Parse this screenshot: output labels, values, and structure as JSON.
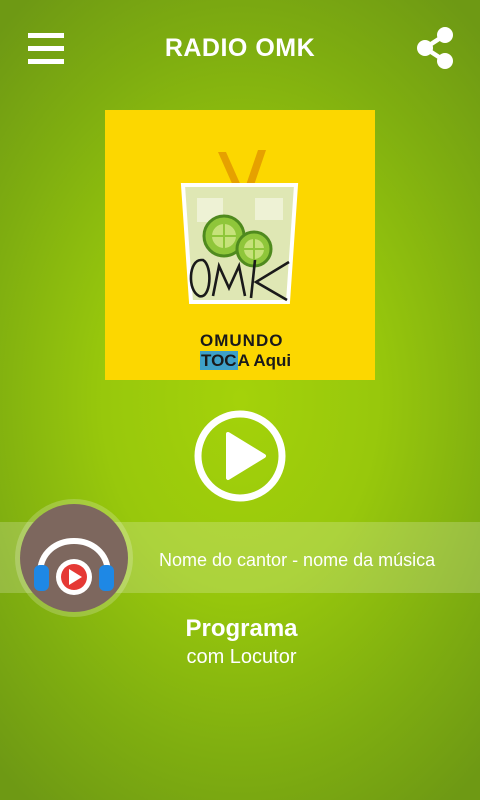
{
  "header": {
    "title": "RADIO OMK",
    "menu_icon": "hamburger-menu-icon",
    "share_icon": "share-icon"
  },
  "logo": {
    "signature": "OMK",
    "line1": "OMUNDO",
    "line2_highlight": "TOC",
    "line2_rest": "A Aqui"
  },
  "player": {
    "play_icon": "play-icon",
    "track": "Nome do cantor - nome da música"
  },
  "program": {
    "avatar_icon": "headphones-icon",
    "title": "Programa",
    "host": "com Locutor"
  },
  "colors": {
    "background_center": "#a4d20a",
    "background_edge": "#6e9914",
    "logo_background": "#fcd700",
    "avatar_background": "#7d675e",
    "headphone_blue": "#1e88e5",
    "play_red": "#e53935"
  }
}
